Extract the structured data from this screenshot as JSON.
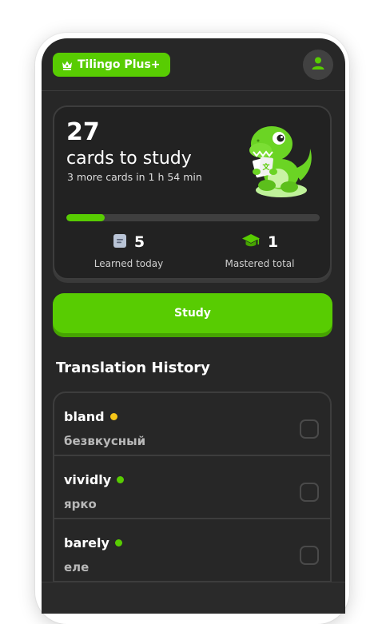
{
  "header": {
    "plus_label": "Tilingo Plus+",
    "plus_icon": "crown-icon",
    "avatar_icon": "user-icon",
    "accent": "#58cc02"
  },
  "study_card": {
    "count": "27",
    "subtitle": "cards to study",
    "next_cards": "3 more cards in 1 h 54 min",
    "progress_fraction": 0.15,
    "stats": [
      {
        "icon": "flashcard-icon",
        "value": "5",
        "label": "Learned today"
      },
      {
        "icon": "graduation-cap-icon",
        "value": "1",
        "label": "Mastered total"
      }
    ]
  },
  "study_button": {
    "label": "Study"
  },
  "history": {
    "title": "Translation History",
    "items": [
      {
        "word": "bland",
        "translation": "безвкусный",
        "status_color": "#f5c518",
        "checked": false
      },
      {
        "word": "vividly",
        "translation": "ярко",
        "status_color": "#58cc02",
        "checked": false
      },
      {
        "word": "barely",
        "translation": "еле",
        "status_color": "#58cc02",
        "checked": false
      }
    ]
  }
}
